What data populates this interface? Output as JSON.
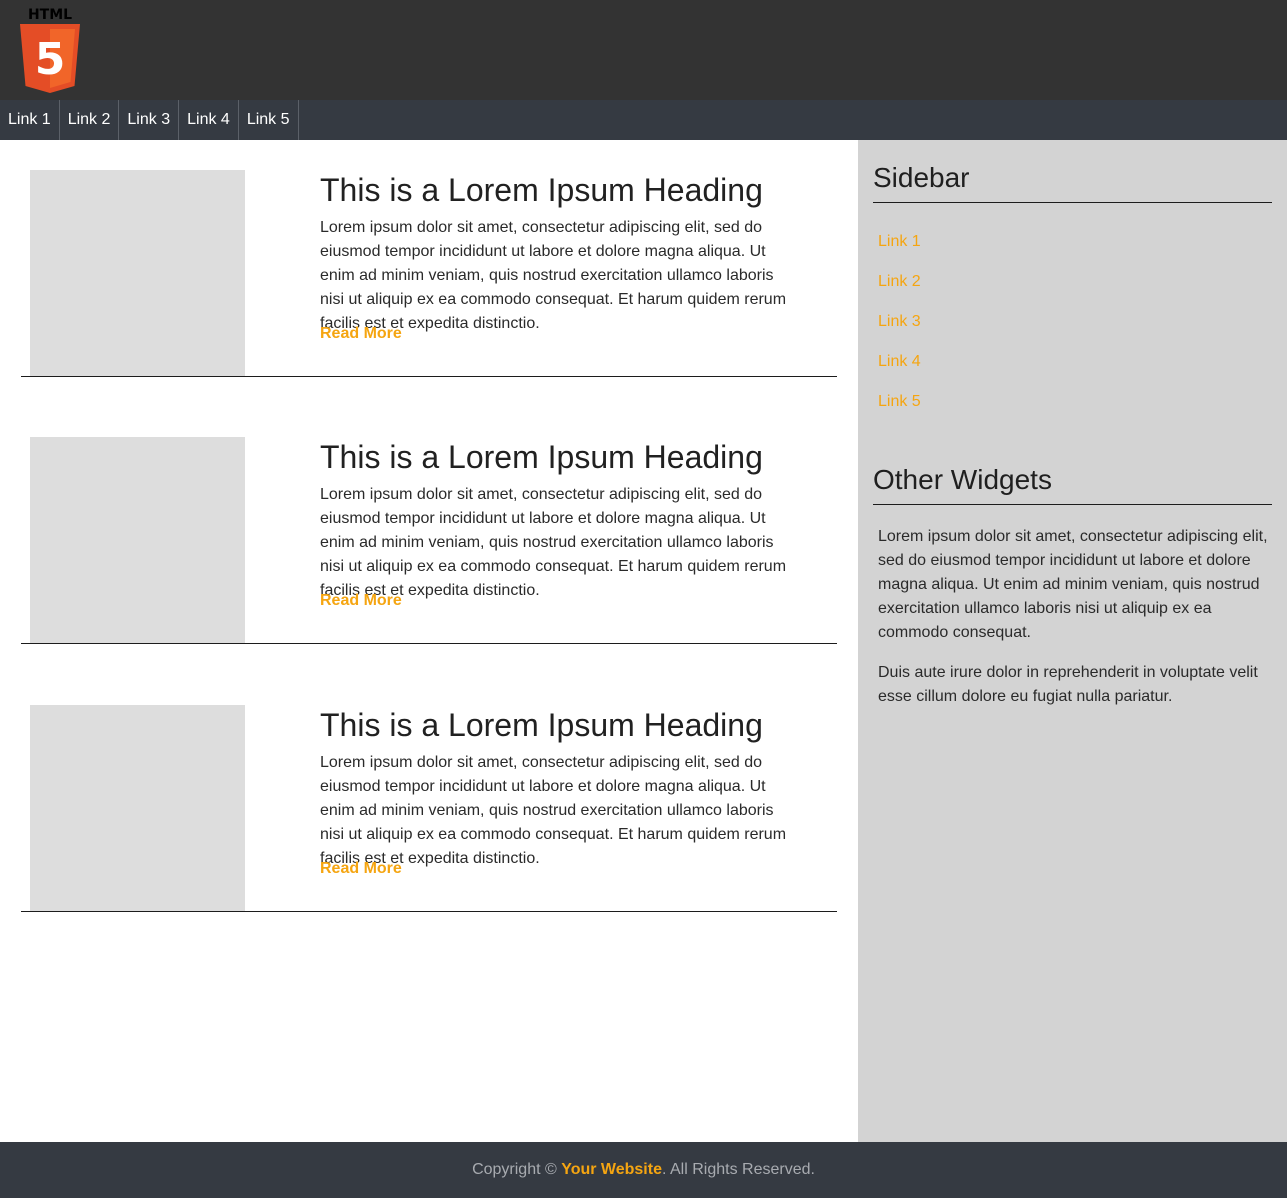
{
  "header": {
    "logo": {
      "icon": "html5-logo-icon",
      "text": "HTML",
      "badge": "5",
      "colors": {
        "shield": "#e44d26",
        "shield_light": "#f16529",
        "mark": "#ffffff",
        "text": "#000000"
      }
    }
  },
  "nav": {
    "items": [
      {
        "label": "Link 1"
      },
      {
        "label": "Link 2"
      },
      {
        "label": "Link 3"
      },
      {
        "label": "Link 4"
      },
      {
        "label": "Link 5"
      }
    ]
  },
  "posts": [
    {
      "heading": "This is a Lorem Ipsum Heading",
      "body": "Lorem ipsum dolor sit amet, consectetur adipiscing elit, sed do eiusmod tempor incididunt ut labore et dolore magna aliqua. Ut enim ad minim veniam, quis nostrud exercitation ullamco laboris nisi ut aliquip ex ea commodo consequat. Et harum quidem rerum facilis est et expedita distinctio.",
      "read_more": "Read More"
    },
    {
      "heading": "This is a Lorem Ipsum Heading",
      "body": "Lorem ipsum dolor sit amet, consectetur adipiscing elit, sed do eiusmod tempor incididunt ut labore et dolore magna aliqua. Ut enim ad minim veniam, quis nostrud exercitation ullamco laboris nisi ut aliquip ex ea commodo consequat. Et harum quidem rerum facilis est et expedita distinctio.",
      "read_more": "Read More"
    },
    {
      "heading": "This is a Lorem Ipsum Heading",
      "body": "Lorem ipsum dolor sit amet, consectetur adipiscing elit, sed do eiusmod tempor incididunt ut labore et dolore magna aliqua. Ut enim ad minim veniam, quis nostrud exercitation ullamco laboris nisi ut aliquip ex ea commodo consequat. Et harum quidem rerum facilis est et expedita distinctio.",
      "read_more": "Read More"
    }
  ],
  "sidebar": {
    "title": "Sidebar",
    "links": [
      {
        "label": "Link 1"
      },
      {
        "label": "Link 2"
      },
      {
        "label": "Link 3"
      },
      {
        "label": "Link 4"
      },
      {
        "label": "Link 5"
      }
    ],
    "widgets_title": "Other Widgets",
    "widgets_paragraphs": [
      "Lorem ipsum dolor sit amet, consectetur adipiscing elit, sed do eiusmod tempor incididunt ut labore et dolore magna aliqua. Ut enim ad minim veniam, quis nostrud exercitation ullamco laboris nisi ut aliquip ex ea commodo consequat.",
      "Duis aute irure dolor in reprehenderit in voluptate velit esse cillum dolore eu fugiat nulla pariatur."
    ]
  },
  "footer": {
    "prefix": "Copyright © ",
    "site_name": "Your Website",
    "suffix": ". All Rights Reserved."
  },
  "colors": {
    "header_bg": "#333333",
    "nav_bg": "#353a42",
    "accent": "#f5a511",
    "sidebar_bg": "#d3d3d3",
    "thumb_bg": "#dddddd"
  }
}
